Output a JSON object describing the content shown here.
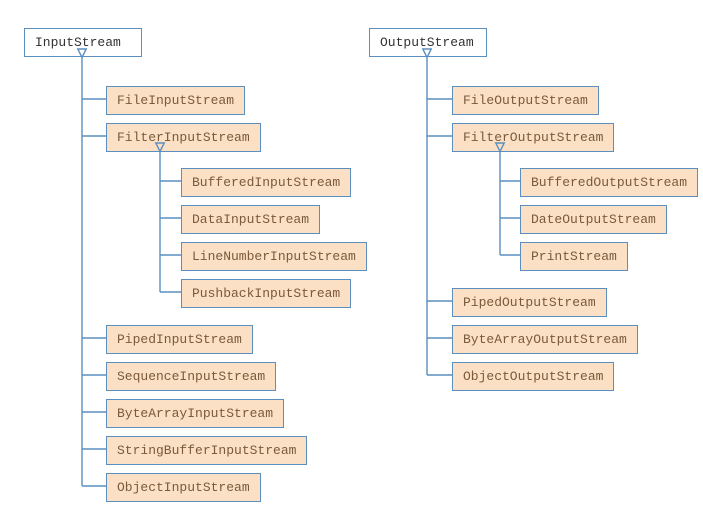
{
  "left": {
    "root": "InputStream",
    "children": [
      {
        "label": "FileInputStream"
      },
      {
        "label": "FilterInputStream",
        "children": [
          {
            "label": "BufferedInputStream"
          },
          {
            "label": "DataInputStream"
          },
          {
            "label": "LineNumberInputStream"
          },
          {
            "label": "PushbackInputStream"
          }
        ]
      },
      {
        "label": "PipedInputStream"
      },
      {
        "label": "SequenceInputStream"
      },
      {
        "label": "ByteArrayInputStream"
      },
      {
        "label": "StringBufferInputStream"
      },
      {
        "label": "ObjectInputStream"
      }
    ]
  },
  "right": {
    "root": "OutputStream",
    "children": [
      {
        "label": "FileOutputStream"
      },
      {
        "label": "FilterOutputStream",
        "children": [
          {
            "label": "BufferedOutputStream"
          },
          {
            "label": "DateOutputStream"
          },
          {
            "label": "PrintStream"
          }
        ]
      },
      {
        "label": "PipedOutputStream"
      },
      {
        "label": "ByteArrayOutputStream"
      },
      {
        "label": "ObjectOutputStream"
      }
    ]
  },
  "colors": {
    "line": "#5a8fbf",
    "childFill": "#fce0c5",
    "rootFill": "#ffffff"
  }
}
